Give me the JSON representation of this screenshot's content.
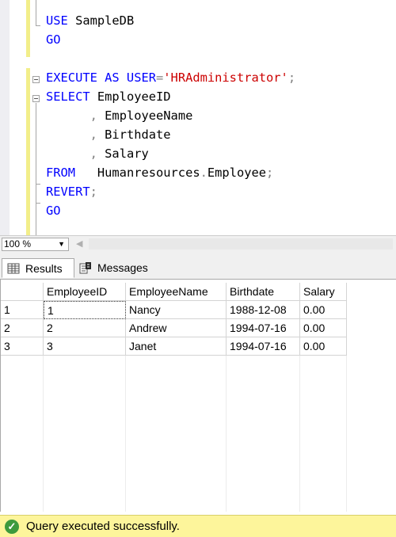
{
  "editor": {
    "lines": [
      {
        "parts": [
          {
            "t": "USE ",
            "c": "kw"
          },
          {
            "t": "SampleDB",
            "c": "ident"
          }
        ]
      },
      {
        "parts": [
          {
            "t": "GO",
            "c": "kw"
          }
        ]
      },
      {
        "parts": []
      },
      {
        "parts": [
          {
            "t": "EXECUTE AS USER",
            "c": "kw"
          },
          {
            "t": "=",
            "c": "op"
          },
          {
            "t": "'HRAdministrator'",
            "c": "str"
          },
          {
            "t": ";",
            "c": "op"
          }
        ]
      },
      {
        "parts": [
          {
            "t": "SELECT ",
            "c": "kw"
          },
          {
            "t": "EmployeeID",
            "c": "ident"
          }
        ]
      },
      {
        "parts": [
          {
            "t": "      ",
            "c": "ident"
          },
          {
            "t": ",",
            "c": "op"
          },
          {
            "t": " EmployeeName",
            "c": "ident"
          }
        ]
      },
      {
        "parts": [
          {
            "t": "      ",
            "c": "ident"
          },
          {
            "t": ",",
            "c": "op"
          },
          {
            "t": " Birthdate",
            "c": "ident"
          }
        ]
      },
      {
        "parts": [
          {
            "t": "      ",
            "c": "ident"
          },
          {
            "t": ",",
            "c": "op"
          },
          {
            "t": " Salary",
            "c": "ident"
          }
        ]
      },
      {
        "parts": [
          {
            "t": "FROM",
            "c": "kw"
          },
          {
            "t": "   Humanresources",
            "c": "ident"
          },
          {
            "t": ".",
            "c": "op"
          },
          {
            "t": "Employee",
            "c": "ident"
          },
          {
            "t": ";",
            "c": "op"
          }
        ]
      },
      {
        "parts": [
          {
            "t": "REVERT",
            "c": "kw"
          },
          {
            "t": ";",
            "c": "op"
          }
        ]
      },
      {
        "parts": [
          {
            "t": "GO",
            "c": "kw"
          }
        ]
      }
    ]
  },
  "zoom": {
    "value": "100 %"
  },
  "tabs": {
    "results_label": "Results",
    "messages_label": "Messages"
  },
  "grid": {
    "columns": [
      "",
      "EmployeeID",
      "EmployeeName",
      "Birthdate",
      "Salary"
    ],
    "rows": [
      [
        "1",
        "1",
        "Nancy",
        "1988-12-08",
        "0.00"
      ],
      [
        "2",
        "2",
        "Andrew",
        "1994-07-16",
        "0.00"
      ],
      [
        "3",
        "3",
        "Janet",
        "1994-07-16",
        "0.00"
      ]
    ]
  },
  "status": {
    "text": "Query executed successfully.",
    "icon": "check-icon",
    "color": "#fdf59b"
  },
  "colors": {
    "keyword": "#0000ff",
    "string": "#cc0000",
    "operator": "#808080",
    "change_bar": "#f2ee8a"
  }
}
